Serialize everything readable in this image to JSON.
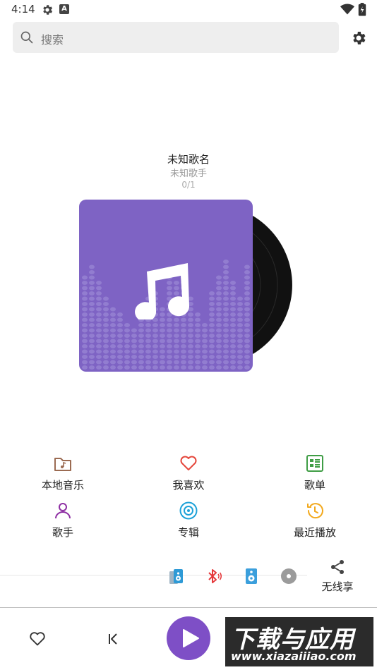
{
  "status_bar": {
    "time": "4:14",
    "icons": [
      "settings-icon",
      "a-badge-icon",
      "wifi-icon",
      "battery-icon"
    ]
  },
  "search": {
    "placeholder": "搜索",
    "icon": "search-icon"
  },
  "header": {
    "settings_icon": "gear-icon"
  },
  "now_playing": {
    "title": "未知歌名",
    "artist": "未知歌手",
    "position": "0/1",
    "album_art_icon": "music-note-icon",
    "album_color": "#7e63c4"
  },
  "menu": [
    {
      "label": "本地音乐",
      "icon": "folder-music-icon",
      "color": "#9b6b52"
    },
    {
      "label": "我喜欢",
      "icon": "heart-icon",
      "color": "#e5483d"
    },
    {
      "label": "歌单",
      "icon": "playlist-icon",
      "color": "#3f9d45"
    },
    {
      "label": "歌手",
      "icon": "person-icon",
      "color": "#8e2fa3"
    },
    {
      "label": "专辑",
      "icon": "disc-icon",
      "color": "#1ea2d8"
    },
    {
      "label": "最近播放",
      "icon": "history-icon",
      "color": "#f2a81b"
    }
  ],
  "devices": {
    "items": [
      "phone-speaker-icon",
      "bluetooth-icon",
      "speaker-icon",
      "add-device-icon"
    ],
    "share_label": "无线享",
    "share_icon": "share-icon"
  },
  "player_bar": {
    "favorite_icon": "heart-outline-icon",
    "prev_icon": "skip-previous-icon",
    "play_icon": "play-icon",
    "accent": "#7e4fc6"
  },
  "watermark": {
    "title": "下载与应用",
    "url": "www.xiazaiiiao.com"
  }
}
